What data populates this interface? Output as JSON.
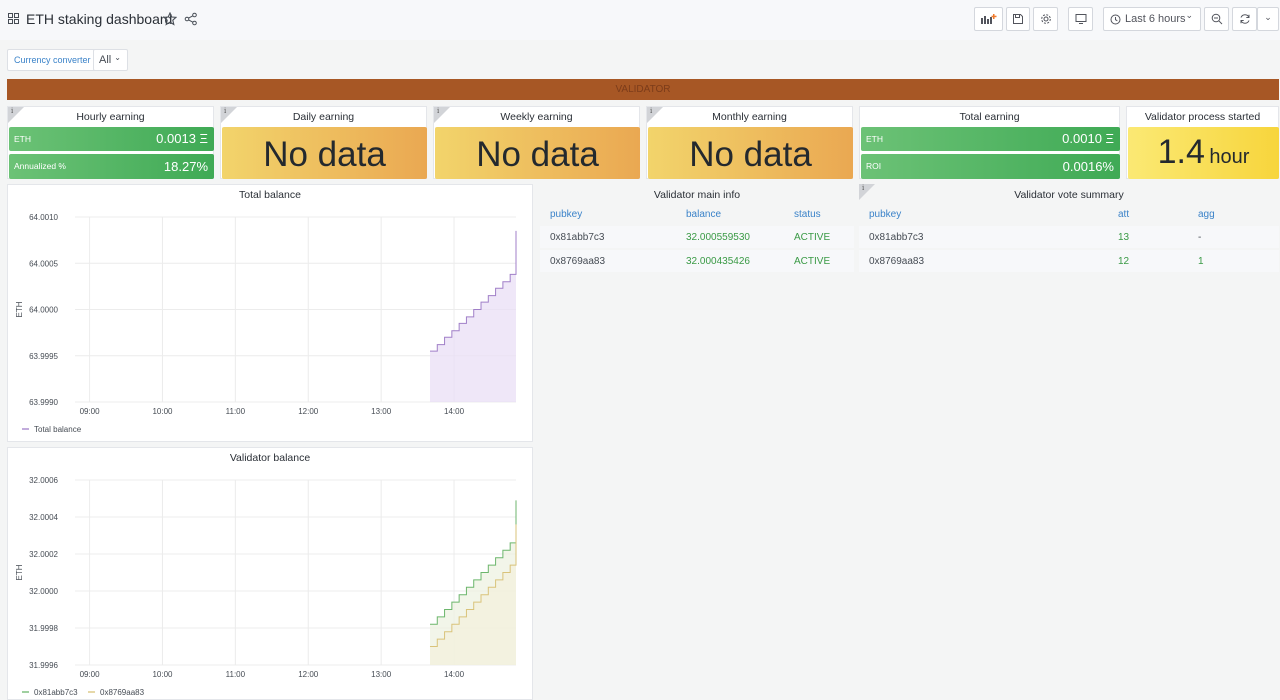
{
  "header": {
    "title": "ETH staking dashboard",
    "time_range": "Last 6 hours"
  },
  "variables": {
    "label": "Currency converter",
    "value": "All"
  },
  "row": {
    "title": "VALIDATOR"
  },
  "stats": {
    "hourly": {
      "title": "Hourly earning",
      "eth_label": "ETH",
      "eth_value": "0.0013 Ξ",
      "ann_label": "Annualized %",
      "ann_value": "18.27%"
    },
    "daily": {
      "title": "Daily earning",
      "value": "No data"
    },
    "weekly": {
      "title": "Weekly earning",
      "value": "No data"
    },
    "monthly": {
      "title": "Monthly earning",
      "value": "No data"
    },
    "total": {
      "title": "Total earning",
      "eth_label": "ETH",
      "eth_value": "0.0010 Ξ",
      "roi_label": "ROI",
      "roi_value": "0.0016%"
    },
    "started": {
      "title": "Validator process started",
      "value": "1.4",
      "unit": "hour"
    }
  },
  "main_info": {
    "title": "Validator main info",
    "columns": [
      "pubkey",
      "balance",
      "status"
    ],
    "rows": [
      {
        "pubkey": "0x81abb7c3",
        "balance": "32.000559530",
        "status": "ACTIVE"
      },
      {
        "pubkey": "0x8769aa83",
        "balance": "32.000435426",
        "status": "ACTIVE"
      }
    ]
  },
  "vote_summary": {
    "title": "Validator vote summary",
    "columns": [
      "pubkey",
      "att",
      "agg"
    ],
    "rows": [
      {
        "pubkey": "0x81abb7c3",
        "att": "13",
        "agg": "-"
      },
      {
        "pubkey": "0x8769aa83",
        "att": "12",
        "agg": "1"
      }
    ]
  },
  "colors": {
    "row": "#a75725",
    "green": "#3faa55",
    "purple": "#a07fc8",
    "olive": "#c8b46a"
  },
  "chart_data": [
    {
      "type": "line",
      "title": "Total balance",
      "ylabel": "ETH",
      "ylim": [
        63.999,
        64.001
      ],
      "yticks": [
        "64.0010",
        "64.0005",
        "64.0000",
        "63.9995",
        "63.9990"
      ],
      "xlim": [
        8.8,
        14.85
      ],
      "xticks": [
        "09:00",
        "10:00",
        "11:00",
        "12:00",
        "13:00",
        "14:00"
      ],
      "legend": "bottom-left",
      "series": [
        {
          "name": "Total balance",
          "color": "#a07fc8",
          "fill": "#eadff5",
          "x": [
            13.67,
            13.77,
            13.87,
            13.97,
            14.07,
            14.17,
            14.27,
            14.37,
            14.47,
            14.57,
            14.67,
            14.77,
            14.85
          ],
          "y": [
            63.99955,
            63.99962,
            63.9997,
            63.99977,
            63.99985,
            63.99992,
            64.0,
            64.00008,
            64.00015,
            64.00023,
            64.0003,
            64.00038,
            64.00085
          ]
        }
      ]
    },
    {
      "type": "line",
      "title": "Validator balance",
      "ylabel": "ETH",
      "ylim": [
        31.9996,
        32.0006
      ],
      "yticks": [
        "32.0006",
        "32.0004",
        "32.0002",
        "32.0000",
        "31.9998",
        "31.9996"
      ],
      "xlim": [
        8.8,
        14.85
      ],
      "xticks": [
        "09:00",
        "10:00",
        "11:00",
        "12:00",
        "13:00",
        "14:00"
      ],
      "legend": "bottom-left",
      "series": [
        {
          "name": "0x81abb7c3",
          "color": "#6cb66c",
          "fill": "#eef1e2",
          "x": [
            13.67,
            13.77,
            13.87,
            13.97,
            14.07,
            14.17,
            14.27,
            14.37,
            14.47,
            14.57,
            14.67,
            14.77,
            14.85
          ],
          "y": [
            31.99982,
            31.99986,
            31.9999,
            31.99994,
            31.99998,
            32.00002,
            32.00006,
            32.0001,
            32.00014,
            32.00018,
            32.00022,
            32.00026,
            32.00049
          ]
        },
        {
          "name": "0x8769aa83",
          "color": "#d9c37a",
          "fill": "#f3f0dc",
          "x": [
            13.67,
            13.77,
            13.87,
            13.97,
            14.07,
            14.17,
            14.27,
            14.37,
            14.47,
            14.57,
            14.67,
            14.77,
            14.85
          ],
          "y": [
            31.9997,
            31.99974,
            31.99978,
            31.99982,
            31.99986,
            31.9999,
            31.99994,
            31.99998,
            32.00002,
            32.00006,
            32.0001,
            32.00014,
            32.00036
          ]
        }
      ]
    }
  ]
}
